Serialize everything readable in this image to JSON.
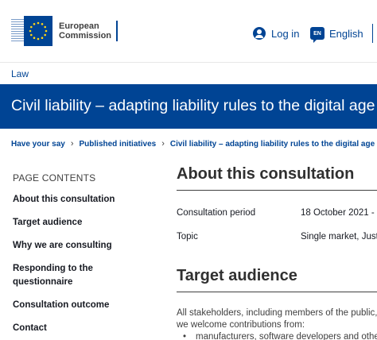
{
  "header": {
    "logo_line1": "European",
    "logo_line2": "Commission",
    "login_label": "Log in",
    "lang_code": "EN",
    "lang_label": "English"
  },
  "section_link": "Law",
  "title": "Civil liability – adapting liability rules to the digital age",
  "breadcrumb": [
    "Have your say",
    "Published initiatives",
    "Civil liability – adapting liability rules to the digital age"
  ],
  "sidebar": {
    "title": "PAGE CONTENTS",
    "items": [
      "About this consultation",
      "Target audience",
      "Why we are consulting",
      "Responding to the questionnaire",
      "Consultation outcome",
      "Contact"
    ]
  },
  "main": {
    "about_heading": "About this consultation",
    "period_label": "Consultation period",
    "period_value": "18 October 2021 -",
    "topic_label": "Topic",
    "topic_value": "Single market, Just",
    "audience_heading": "Target audience",
    "audience_line1": "All stakeholders, including members of the public,",
    "audience_line2": "we welcome contributions from:",
    "bullet1": "manufacturers, software developers and other"
  },
  "colors": {
    "brand": "#004494",
    "text": "#171a22"
  }
}
